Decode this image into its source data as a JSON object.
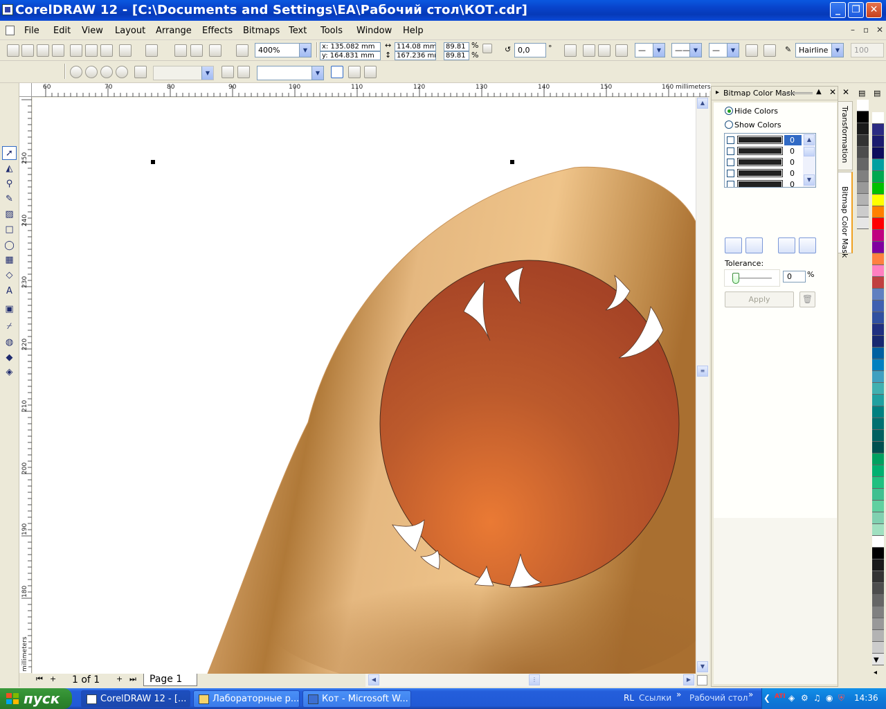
{
  "window": {
    "title": "CorelDRAW 12 - [C:\\Documents and Settings\\EA\\Рабочий стол\\КОТ.cdr]"
  },
  "menu": [
    "File",
    "Edit",
    "View",
    "Layout",
    "Arrange",
    "Effects",
    "Bitmaps",
    "Text",
    "Tools",
    "Window",
    "Help"
  ],
  "toolbar": {
    "zoom": "400%",
    "x": "x: 135.082 mm",
    "y": "y: 164.831 mm",
    "width": "114.08 mm",
    "height": "167.236 mr",
    "scale_x": "89.81",
    "scale_y": "89.81",
    "pct_x": "%",
    "pct_y": "%",
    "rotation": "0,0",
    "degree": "°",
    "outline": "Hairline",
    "opacity": "100"
  },
  "rulers": {
    "top": [
      "60",
      "70",
      "80",
      "90",
      "100",
      "110",
      "120",
      "130",
      "140",
      "150",
      "160"
    ],
    "unit": "millimeters",
    "left": [
      "250",
      "240",
      "230",
      "220",
      "210",
      "200",
      "190",
      "180"
    ]
  },
  "docker": {
    "title": "Bitmap Color Mask",
    "hide_colors": "Hide Colors",
    "show_colors": "Show Colors",
    "color_values": [
      "0",
      "0",
      "0",
      "0",
      "0"
    ],
    "tolerance_label": "Tolerance:",
    "tolerance_value": "0",
    "tolerance_unit": "%",
    "apply": "Apply",
    "tabs": [
      "Transformation",
      "Bitmap Color Mask"
    ]
  },
  "page_nav": {
    "count": "1 of 1",
    "page_tab": "Page 1"
  },
  "taskbar": {
    "start": "пуск",
    "tasks": [
      "CorelDRAW 12 - [...",
      "Лабораторные р...",
      "Кот - Microsoft W..."
    ],
    "lang": "RL",
    "links": "Ссылки",
    "desktop": "Рабочий стол",
    "clock": "14:36"
  },
  "palette_colors": [
    "#ffffff",
    "#000000",
    "#1a1a1a",
    "#333333",
    "#4d4d4d",
    "#666666",
    "#808080",
    "#999999",
    "#b3b3b3",
    "#cccccc",
    "#e6e6e6",
    "#ffffff",
    "#2b2b82",
    "#1b1b6e",
    "#0d0d5c",
    "#00a0a0",
    "#00a850",
    "#00c000",
    "#ffff00",
    "#ff8000",
    "#ff0000",
    "#c00080",
    "#8000a0",
    "#ff8040",
    "#ff80c0",
    "#c04040",
    "#6080c0",
    "#4060b0",
    "#3050a0",
    "#203080",
    "#182870",
    "#0060a0",
    "#0080c0",
    "#40a0c0",
    "#40b0b0",
    "#20a0a0",
    "#008080",
    "#007070",
    "#006060",
    "#005050",
    "#00a060",
    "#00b070",
    "#20c080",
    "#40c090",
    "#60d0a0",
    "#80d0b0",
    "#a0e0c0"
  ]
}
